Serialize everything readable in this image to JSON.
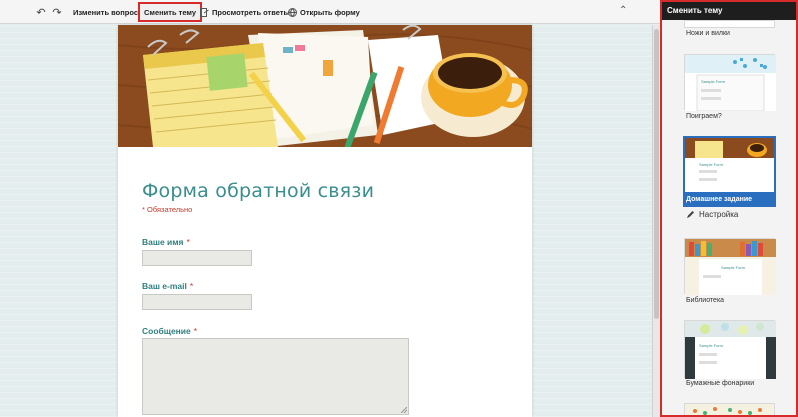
{
  "toolbar": {
    "edit_questions": "Изменить вопросы",
    "change_theme": "Сменить тему",
    "view_responses": "Просмотреть ответы",
    "open_form": "Открыть форму"
  },
  "form": {
    "title": "Форма обратной связи",
    "required_note": "* Обязательно",
    "fields": [
      {
        "label": "Ваше имя",
        "required": "*"
      },
      {
        "label": "Ваш e-mail",
        "required": "*"
      },
      {
        "label": "Сообщение",
        "required": "*"
      }
    ]
  },
  "panel": {
    "title": "Сменить тему",
    "themes": [
      {
        "name": "Ножи и вилки"
      },
      {
        "name": "Поиграем?",
        "preview_title": "Sample Form"
      },
      {
        "name": "Домашнее задание",
        "preview_title": "Sample Form",
        "selected": true
      },
      {
        "name": "Библиотека",
        "preview_title": "Sample Form"
      },
      {
        "name": "Бумажные фонарики",
        "preview_title": "Sample Form"
      }
    ],
    "settings_label": "Настройка"
  },
  "colors": {
    "accent": "#3a8e8e",
    "required": "#c43a2a",
    "highlight": "#d62b2b",
    "selected": "#2a6fbf"
  }
}
